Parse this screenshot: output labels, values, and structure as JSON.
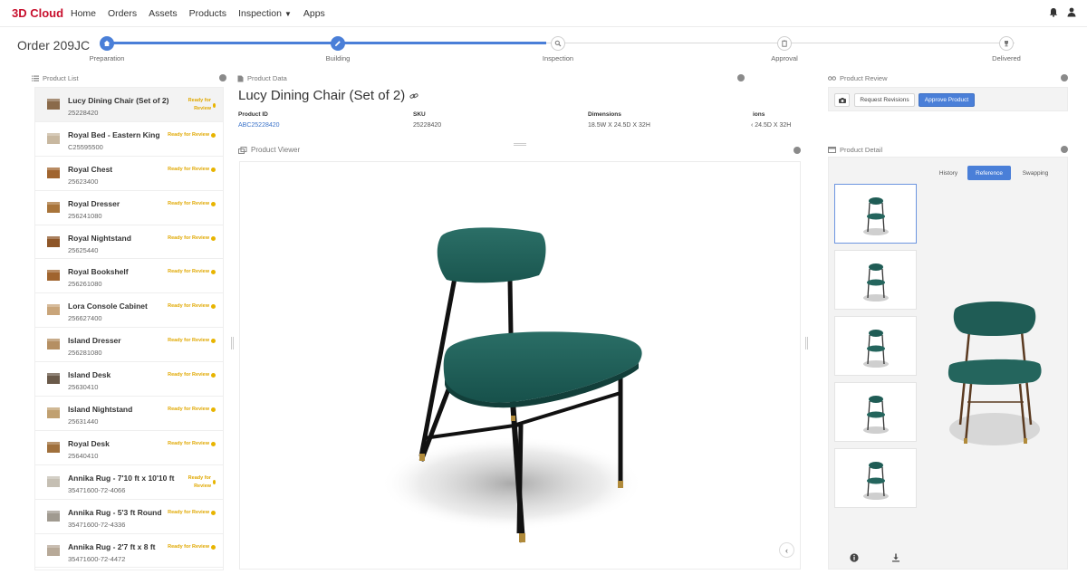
{
  "brand": "3D Cloud",
  "nav": [
    "Home",
    "Orders",
    "Assets",
    "Products",
    "Inspection",
    "Apps"
  ],
  "order_title": "Order 209JC",
  "steps": [
    {
      "label": "Preparation",
      "state": "done"
    },
    {
      "label": "Building",
      "state": "done"
    },
    {
      "label": "Inspection",
      "state": "todo"
    },
    {
      "label": "Approval",
      "state": "todo"
    },
    {
      "label": "Delivered",
      "state": "todo"
    }
  ],
  "panels": {
    "product_list": "Product List",
    "product_data": "Product Data",
    "product_viewer": "Product Viewer",
    "product_review": "Product Review",
    "product_detail": "Product Detail"
  },
  "products": [
    {
      "name": "Lucy Dining Chair (Set of 2)",
      "id": "25228420",
      "status": "Ready for Review",
      "selected": true
    },
    {
      "name": "Royal Bed - Eastern King",
      "id": "C25595500",
      "status": "Ready for Review"
    },
    {
      "name": "Royal Chest",
      "id": "25623400",
      "status": "Ready for Review"
    },
    {
      "name": "Royal Dresser",
      "id": "256241080",
      "status": "Ready for Review"
    },
    {
      "name": "Royal Nightstand",
      "id": "25625440",
      "status": "Ready for Review"
    },
    {
      "name": "Royal Bookshelf",
      "id": "256261080",
      "status": "Ready for Review"
    },
    {
      "name": "Lora Console Cabinet",
      "id": "256627400",
      "status": "Ready for Review"
    },
    {
      "name": "Island Dresser",
      "id": "256281080",
      "status": "Ready for Review"
    },
    {
      "name": "Island Desk",
      "id": "25630410",
      "status": "Ready for Review"
    },
    {
      "name": "Island Nightstand",
      "id": "25631440",
      "status": "Ready for Review"
    },
    {
      "name": "Royal Desk",
      "id": "25640410",
      "status": "Ready for Review"
    },
    {
      "name": "Annika Rug - 7'10 ft x 10'10 ft",
      "id": "35471600-72-4066",
      "status": "Ready for Review"
    },
    {
      "name": "Annika Rug - 5'3 ft Round",
      "id": "35471600-72-4336",
      "status": "Ready for Review"
    },
    {
      "name": "Annika Rug - 2'7 ft x 8 ft",
      "id": "35471600-72-4472",
      "status": "Ready for Review"
    }
  ],
  "product": {
    "title": "Lucy Dining Chair (Set of 2)",
    "fields": [
      {
        "label": "Product ID",
        "value": "ABC25228420"
      },
      {
        "label": "SKU",
        "value": "25228420"
      },
      {
        "label": "Dimensions",
        "value": "18.5W X 24.5D X 32H"
      },
      {
        "label": "ions",
        "value": "‹ 24.5D X 32H"
      }
    ]
  },
  "review": {
    "request_label": "Request Revisions",
    "approve_label": "Approve Product"
  },
  "detail": {
    "tabs": [
      "History",
      "Reference",
      "Swapping"
    ],
    "active_tab": "Reference"
  },
  "colors": {
    "brand": "#c8102e",
    "accent": "#4a7fd8",
    "status": "#e0a800",
    "chair_green": "#1f5c55"
  }
}
